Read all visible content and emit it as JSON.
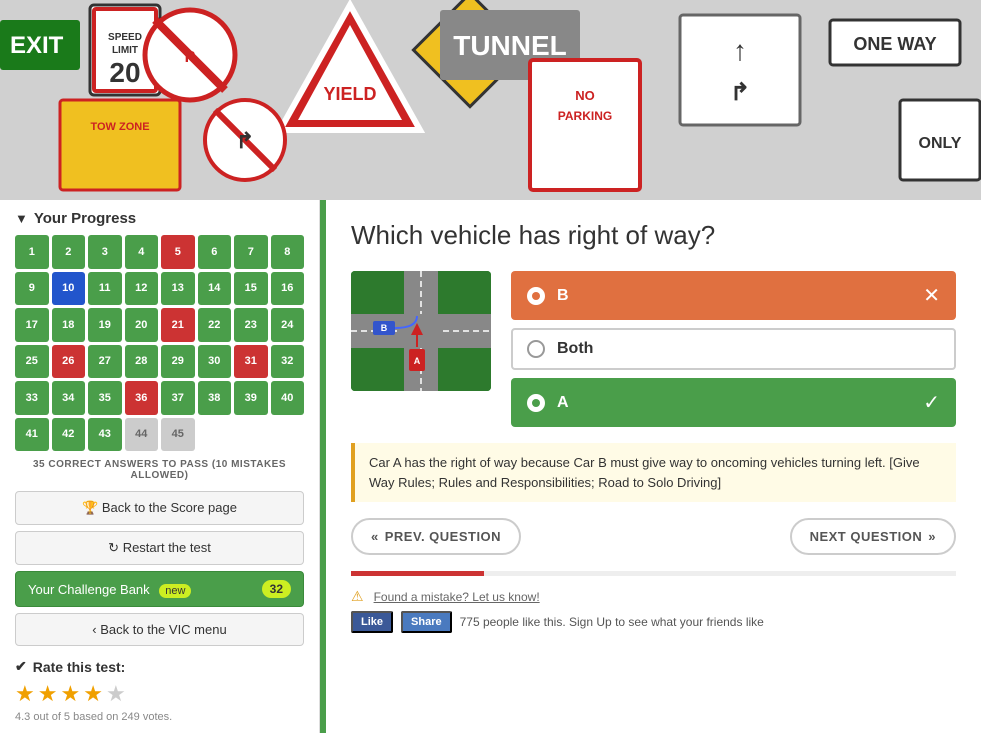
{
  "hero": {
    "alt": "Road signs collage"
  },
  "sidebar": {
    "progress_header": "Your Progress",
    "grid_cells": [
      {
        "num": 1,
        "type": "green"
      },
      {
        "num": 2,
        "type": "green"
      },
      {
        "num": 3,
        "type": "green"
      },
      {
        "num": 4,
        "type": "green"
      },
      {
        "num": 5,
        "type": "red"
      },
      {
        "num": 6,
        "type": "green"
      },
      {
        "num": 7,
        "type": "green"
      },
      {
        "num": 8,
        "type": "green"
      },
      {
        "num": 9,
        "type": "green"
      },
      {
        "num": 10,
        "type": "blue"
      },
      {
        "num": 11,
        "type": "green"
      },
      {
        "num": 12,
        "type": "green"
      },
      {
        "num": 13,
        "type": "green"
      },
      {
        "num": 14,
        "type": "green"
      },
      {
        "num": 15,
        "type": "green"
      },
      {
        "num": 16,
        "type": "green"
      },
      {
        "num": 17,
        "type": "green"
      },
      {
        "num": 18,
        "type": "green"
      },
      {
        "num": 19,
        "type": "green"
      },
      {
        "num": 20,
        "type": "green"
      },
      {
        "num": 21,
        "type": "red"
      },
      {
        "num": 22,
        "type": "green"
      },
      {
        "num": 23,
        "type": "green"
      },
      {
        "num": 24,
        "type": "green"
      },
      {
        "num": 25,
        "type": "green"
      },
      {
        "num": 26,
        "type": "red"
      },
      {
        "num": 27,
        "type": "green"
      },
      {
        "num": 28,
        "type": "green"
      },
      {
        "num": 29,
        "type": "green"
      },
      {
        "num": 30,
        "type": "green"
      },
      {
        "num": 31,
        "type": "red"
      },
      {
        "num": 32,
        "type": "green"
      },
      {
        "num": 33,
        "type": "green"
      },
      {
        "num": 34,
        "type": "green"
      },
      {
        "num": 35,
        "type": "green"
      },
      {
        "num": 36,
        "type": "red"
      },
      {
        "num": 37,
        "type": "green"
      },
      {
        "num": 38,
        "type": "green"
      },
      {
        "num": 39,
        "type": "green"
      },
      {
        "num": 40,
        "type": "green"
      },
      {
        "num": 41,
        "type": "green"
      },
      {
        "num": 42,
        "type": "green"
      },
      {
        "num": 43,
        "type": "green"
      },
      {
        "num": 44,
        "type": "gray"
      },
      {
        "num": 45,
        "type": "gray"
      }
    ],
    "pass_text": "35 CORRECT ANSWERS TO PASS (10 MISTAKES ALLOWED)",
    "btn_score": "Back to the Score page",
    "btn_restart": "Restart the test",
    "btn_challenge": "Your Challenge Bank",
    "btn_challenge_badge": "new",
    "btn_challenge_count": "32",
    "btn_vic": "Back to the VIC menu",
    "rate_title": "Rate this test:",
    "stars": [
      {
        "filled": true
      },
      {
        "filled": true
      },
      {
        "filled": true
      },
      {
        "filled": true
      },
      {
        "filled": false
      }
    ],
    "rating_text": "4.3 out of 5 based on 249 votes."
  },
  "content": {
    "question": "Which vehicle has right of way?",
    "answers": [
      {
        "label": "B",
        "state": "wrong",
        "selected": true
      },
      {
        "label": "Both",
        "state": "neutral",
        "selected": false
      },
      {
        "label": "A",
        "state": "correct",
        "selected": false
      }
    ],
    "explanation": "Car A has the right of way because Car B must give way to oncoming vehicles turning left. [Give Way Rules; Rules and Responsibilities; Road to Solo Driving]",
    "prev_btn": "PREV. QUESTION",
    "next_btn": "NEXT QUESTION",
    "progress_percent": 22,
    "mistake_text": "Found a mistake? Let us know!",
    "social": {
      "like": "Like",
      "share": "Share",
      "count": "775 people like this.",
      "signup": "Sign Up",
      "suffix": "to see what your friends",
      "like_word": "like"
    }
  }
}
